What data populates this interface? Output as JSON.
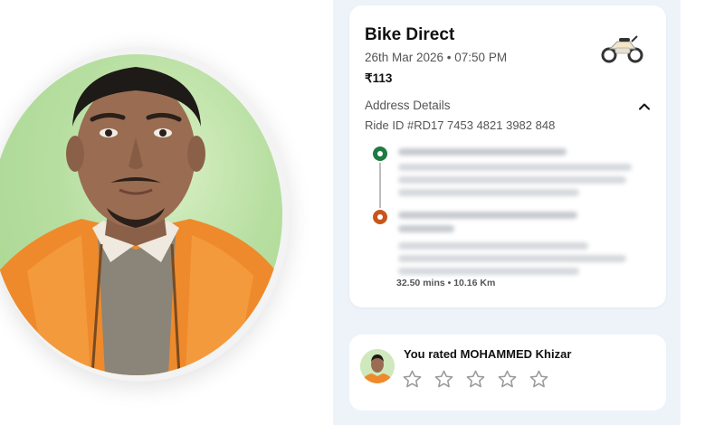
{
  "trip": {
    "title": "Bike Direct",
    "datetime": "26th Mar 2026 • 07:50 PM",
    "fare": "₹113",
    "vehicle_icon": "motorbike-icon"
  },
  "address": {
    "section_label": "Address Details",
    "toggle_icon": "chevron-up-icon",
    "ride_id": "Ride ID #RD17 7453 4821 3982 848",
    "pickup_icon": "pickup-pin-icon",
    "drop_icon": "drop-pin-icon",
    "trip_meta": "32.50 mins • 10.16 Km",
    "colors": {
      "pickup": "#1f7a45",
      "drop": "#c8561b"
    }
  },
  "rating": {
    "text": "You rated MOHAMMED Khizar",
    "star_icon": "star-outline-icon",
    "stars_filled": 0,
    "stars_total": 5
  },
  "colors": {
    "panel_bg": "#eef3fa",
    "card_bg": "#ffffff",
    "star_outline": "#9a9a9a"
  }
}
